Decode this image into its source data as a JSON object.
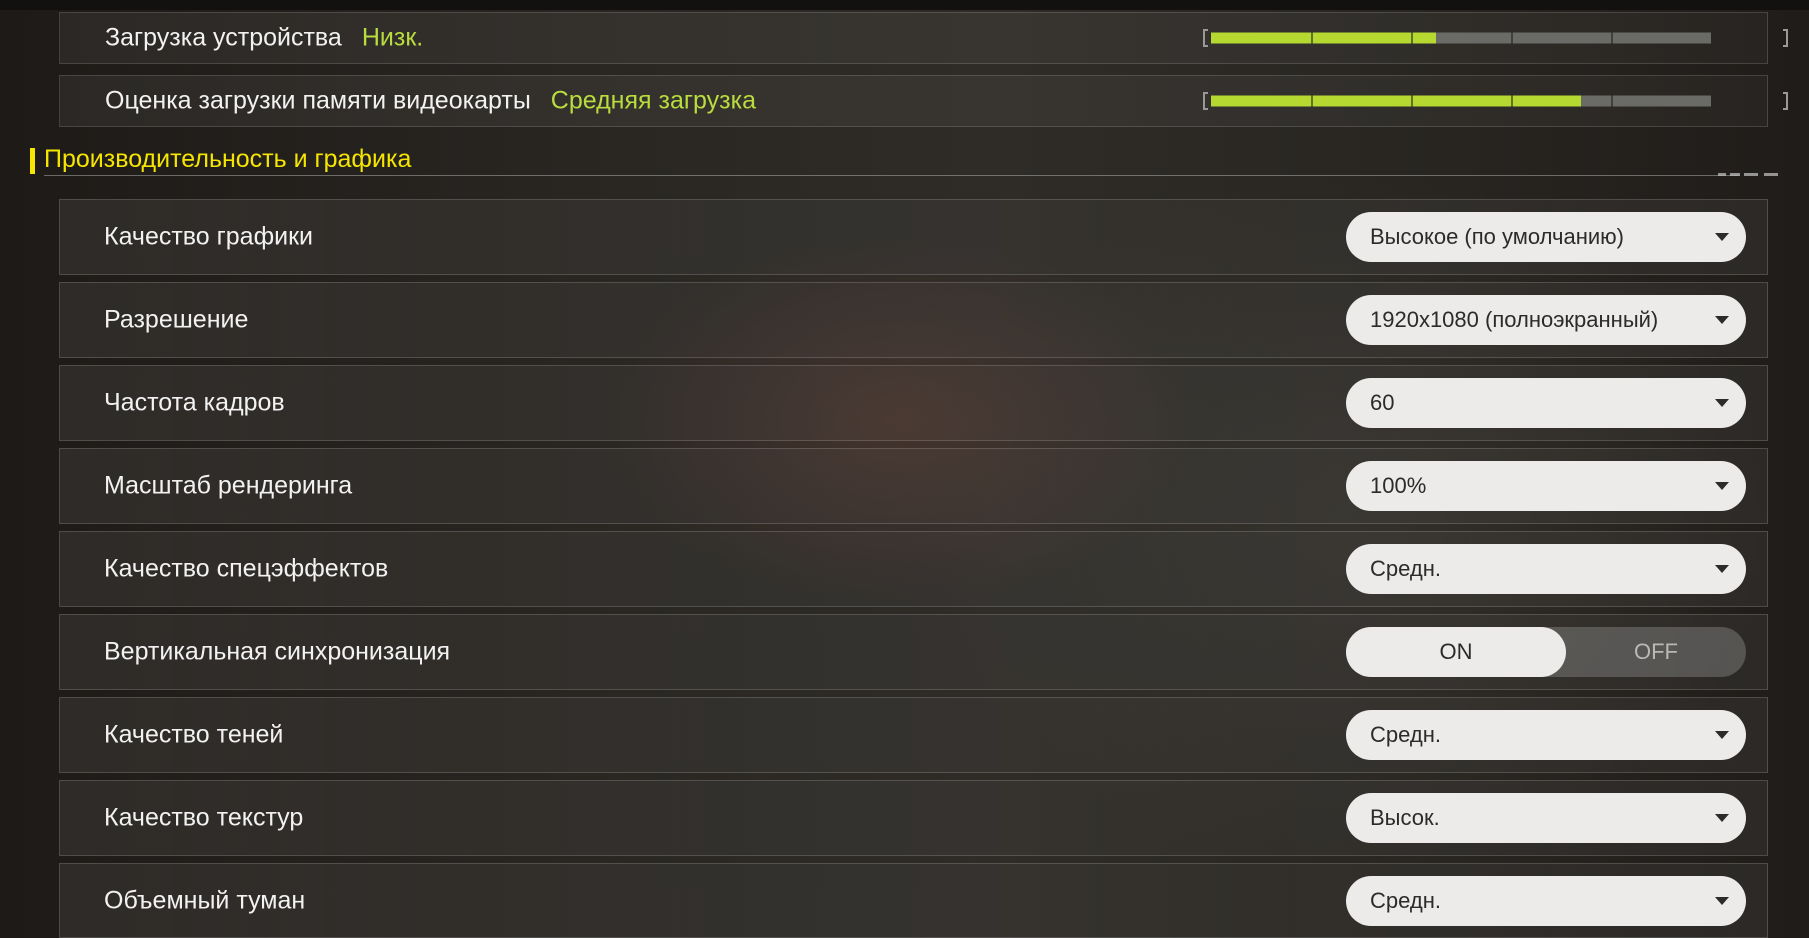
{
  "device_load": {
    "label": "Загрузка устройства",
    "value": "Низк.",
    "level": 0.45
  },
  "vram_load": {
    "label": "Оценка загрузки памяти видеокарты",
    "value": "Средняя загрузка",
    "level": 0.74
  },
  "section": {
    "title": "Производительность и графика"
  },
  "settings": [
    {
      "label": "Качество графики",
      "type": "dropdown",
      "value": "Высокое (по умолчанию)"
    },
    {
      "label": "Разрешение",
      "type": "dropdown",
      "value": "1920x1080 (полноэкранный)"
    },
    {
      "label": "Частота кадров",
      "type": "dropdown",
      "value": "60"
    },
    {
      "label": "Масштаб рендеринга",
      "type": "dropdown",
      "value": "100%"
    },
    {
      "label": "Качество спецэффектов",
      "type": "dropdown",
      "value": "Средн."
    },
    {
      "label": "Вертикальная синхронизация",
      "type": "toggle",
      "on_label": "ON",
      "off_label": "OFF",
      "value": "ON"
    },
    {
      "label": "Качество теней",
      "type": "dropdown",
      "value": "Средн."
    },
    {
      "label": "Качество текстур",
      "type": "dropdown",
      "value": "Высок."
    },
    {
      "label": "Объемный туман",
      "type": "dropdown",
      "value": "Средн."
    }
  ],
  "colors": {
    "accent_yellow": "#f5e500",
    "meter_green": "#b5d930",
    "value_green": "#b9dc3e"
  }
}
